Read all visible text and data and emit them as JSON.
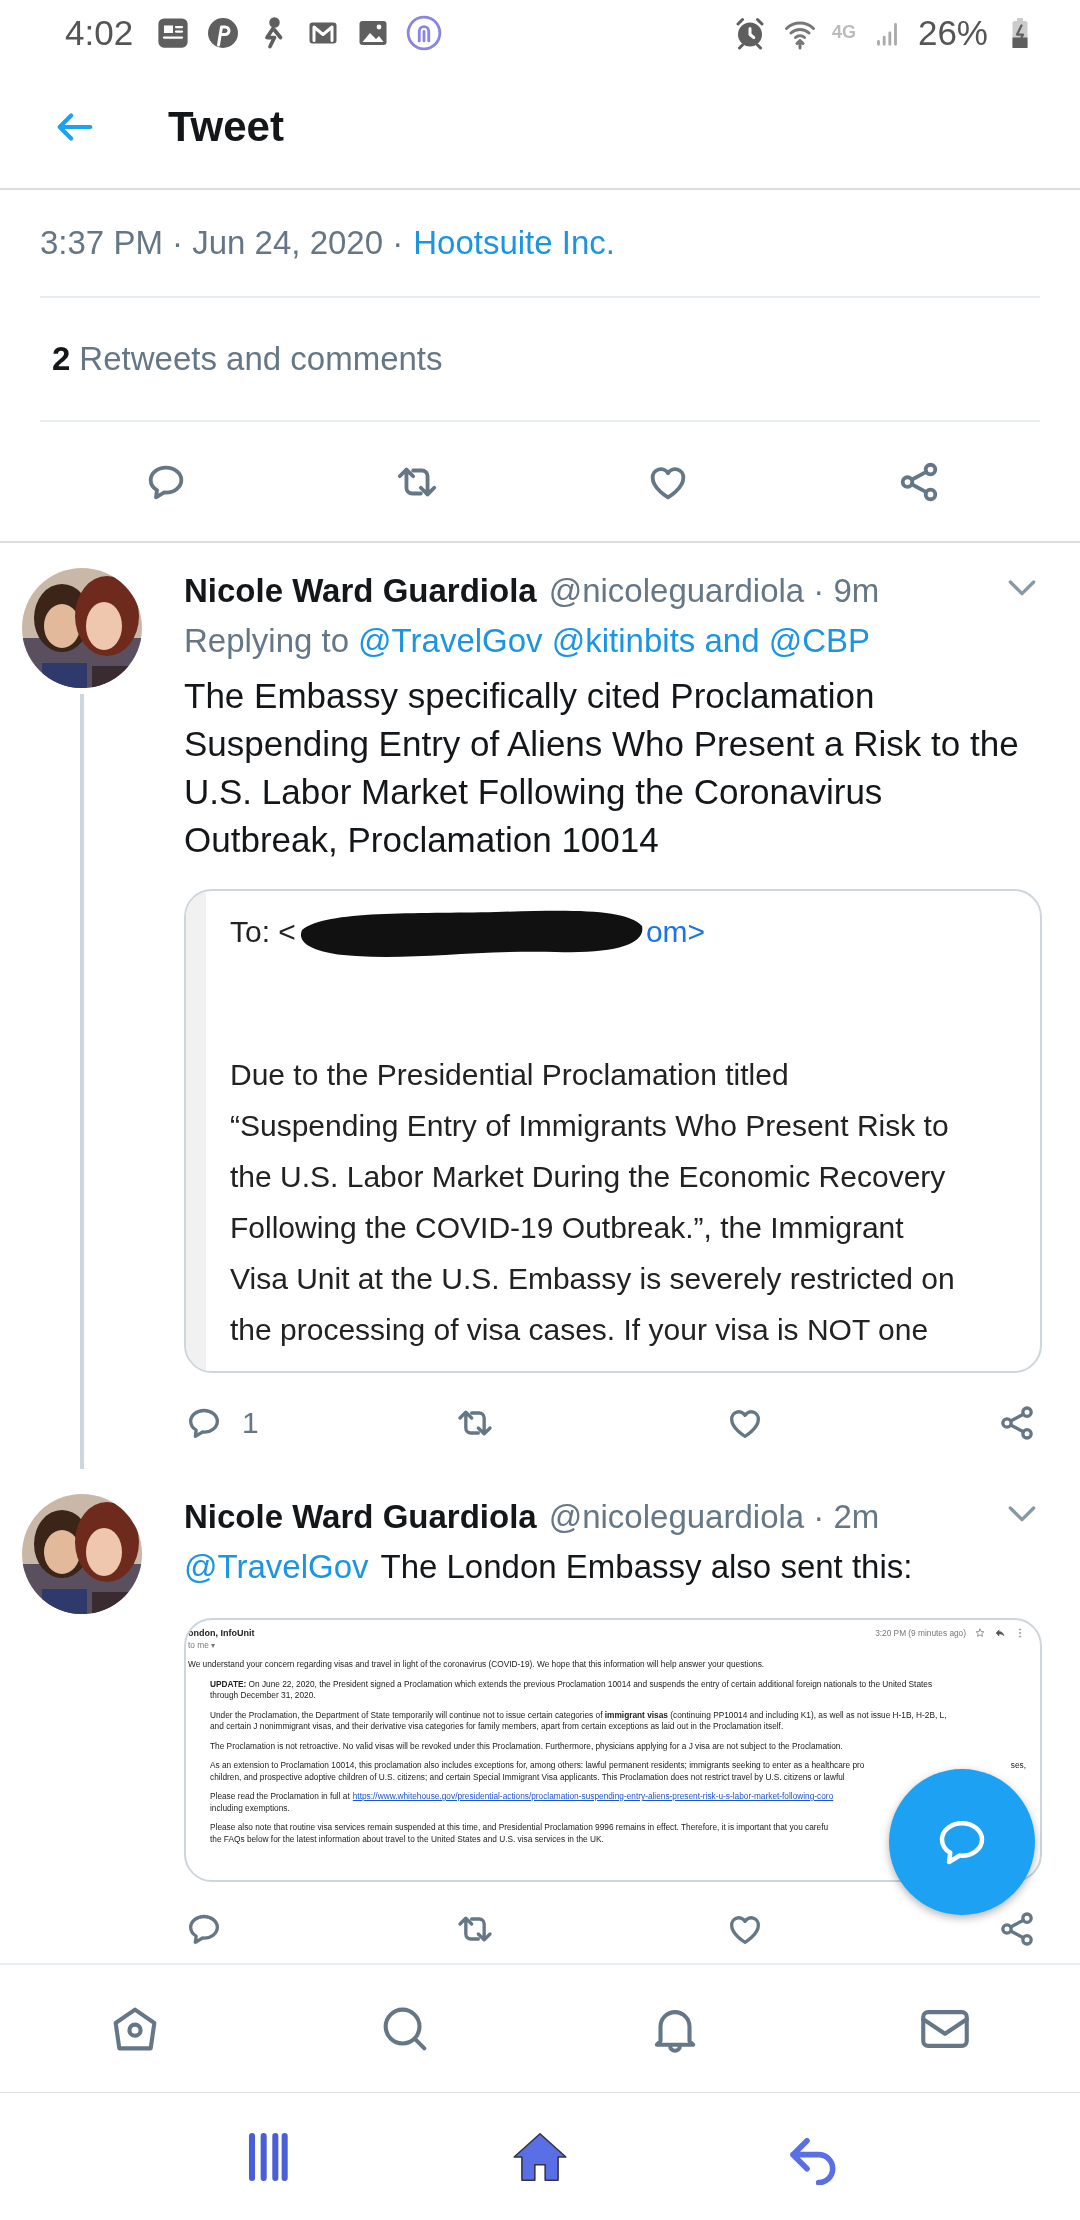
{
  "status_bar": {
    "time": "4:02",
    "network": "4G",
    "battery": "26%"
  },
  "header": {
    "title": "Tweet"
  },
  "meta": {
    "timestamp": "3:37 PM · Jun 24, 2020 ·",
    "source": "Hootsuite Inc."
  },
  "stats": {
    "count": "2",
    "label": "Retweets and comments"
  },
  "replies": [
    {
      "name": "Nicole Ward Guardiola",
      "handle": "@nicoleguardiola · 9m",
      "replying_label": "Replying to",
      "replying_to": "@TravelGov @kitinbits and @CBP",
      "text": "The Embassy specifically cited Proclamation Suspending Entry of Aliens Who Present a Risk to the U.S. Labor Market Following the Coronavirus Outbreak, Proclamation 10014",
      "reply_count": "1",
      "thread": true,
      "attachment": {
        "kind": "email_text",
        "to_label": "To: <",
        "to_tail": "om>",
        "lines": [
          "Due to the Presidential Proclamation titled",
          "“Suspending Entry of Immigrants Who Present Risk to",
          "the U.S. Labor Market During the Economic Recovery",
          "Following the COVID-19 Outbreak.”, the Immigrant",
          "Visa Unit at the U.S. Embassy is severely restricted on",
          "the processing of visa cases. If your visa is NOT one"
        ]
      }
    },
    {
      "name": "Nicole Ward Guardiola",
      "handle": "@nicoleguardiola · 2m",
      "mention": "@TravelGov",
      "text": "The London Embassy also sent this:",
      "thread": false,
      "attachment": {
        "kind": "email_thumb",
        "sender": "ondon, InfoUnit",
        "recipient": "to me ▾",
        "time": "3:20 PM (9 minutes ago)",
        "paragraphs": [
          {
            "indented": false,
            "lines": [
              {
                "text": "We understand your concern regarding visas and travel in light of the coronavirus (COVID-19). We hope that this information will help answer your questions."
              }
            ]
          },
          {
            "indented": true,
            "lines": [
              {
                "text": "**UPDATE:** On June 22, 2020, the President signed a Proclamation which extends the previous Proclamation 10014 and suspends the entry of certain additional foreign nationals to the United States"
              },
              {
                "text": "through December 31, 2020."
              }
            ]
          },
          {
            "indented": true,
            "lines": [
              {
                "text": "Under the Proclamation, the Department of State temporarily will continue not to issue certain categories of **immigrant visas** (continuing PP10014 and including K1), as well as not issue H-1B, H-2B, L,"
              },
              {
                "text": "and certain J nonimmigrant visas, and their derivative visa categories for family members, apart from certain exceptions as laid out in the Proclamation itself."
              }
            ]
          },
          {
            "indented": true,
            "lines": [
              {
                "text": "The Proclamation is not retroactive. No valid visas will be revoked under this Proclamation. Furthermore, physicians applying for a J visa are not subject to the Proclamation."
              }
            ]
          },
          {
            "indented": true,
            "lines": [
              {
                "text": "As an extension to Proclamation 10014, this proclamation also includes exceptions for, among others: lawful permanent residents; immigrants seeking to enter as a healthcare pro",
                "tail": "ses,"
              },
              {
                "text": "children, and prospective adoptive children of U.S. citizens; and certain Special Immigrant Visa applicants. This Proclamation does not restrict travel by U.S. citizens or lawful"
              }
            ]
          },
          {
            "indented": true,
            "lines": [
              {
                "text": "Please read the Proclamation in full at",
                "link": "https://www.whitehouse.gov/presidential-actions/proclamation-suspending-entry-aliens-present-risk-u-s-labor-market-following-coro"
              },
              {
                "text": "including exemptions."
              }
            ]
          },
          {
            "indented": true,
            "lines": [
              {
                "text": "Please also note that routine visa services remain suspended at this time, and Presidential Proclamation 9996 remains in effect. Therefore, it is important that you carefu"
              },
              {
                "text": "the FAQs below for the latest information about travel to the United States and U.S. visa services in the UK."
              }
            ]
          }
        ]
      }
    }
  ]
}
